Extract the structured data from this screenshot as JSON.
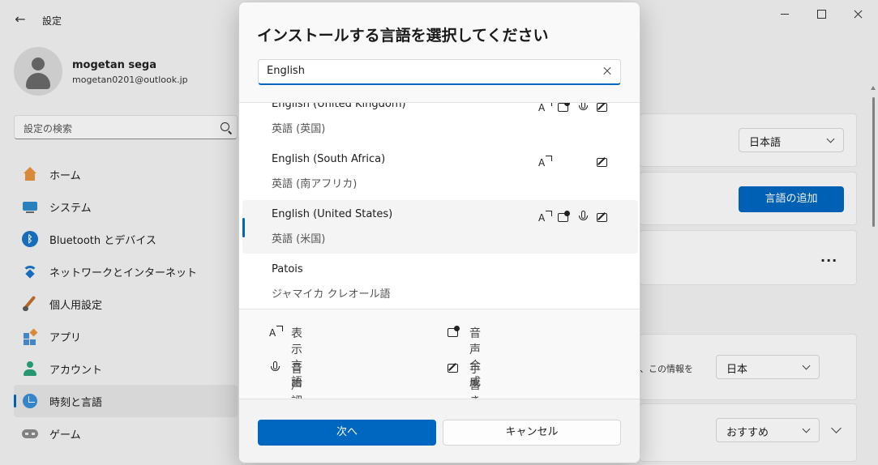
{
  "window": {
    "title": "設定"
  },
  "user": {
    "name": "mogetan sega",
    "email": "mogetan0201@outlook.jp"
  },
  "search": {
    "placeholder": "設定の検索"
  },
  "sidebar": {
    "items": [
      {
        "label": "ホーム",
        "icon": "home-icon"
      },
      {
        "label": "システム",
        "icon": "system-icon"
      },
      {
        "label": "Bluetooth とデバイス",
        "icon": "bluetooth-icon"
      },
      {
        "label": "ネットワークとインターネット",
        "icon": "wifi-icon"
      },
      {
        "label": "個人用設定",
        "icon": "brush-icon"
      },
      {
        "label": "アプリ",
        "icon": "apps-icon"
      },
      {
        "label": "アカウント",
        "icon": "account-icon"
      },
      {
        "label": "時刻と言語",
        "icon": "clock-globe-icon"
      },
      {
        "label": "ゲーム",
        "icon": "controller-icon"
      }
    ],
    "active_index": 7
  },
  "background": {
    "display_language": "日本語",
    "add_language_button": "言語の追加",
    "more_button": "...",
    "region_hint": "、この情報を",
    "region_value": "日本",
    "format_value": "おすすめ"
  },
  "dialog": {
    "title": "インストールする言語を選択してください",
    "search_value": "English",
    "languages": [
      {
        "name": "English (United Kingdom)",
        "native": "英語 (英国)",
        "caps": [
          "display",
          "tts",
          "speech",
          "handwriting"
        ]
      },
      {
        "name": "English (South Africa)",
        "native": "英語 (南アフリカ)",
        "caps": [
          "display",
          "handwriting"
        ]
      },
      {
        "name": "English (United States)",
        "native": "英語 (米国)",
        "caps": [
          "display",
          "tts",
          "speech",
          "handwriting"
        ],
        "selected": true
      },
      {
        "name": "Patois",
        "native": "ジャマイカ クレオール語",
        "caps": []
      }
    ],
    "legend": {
      "display": "表示言語",
      "tts": "音声合成",
      "speech": "音声認識",
      "handwriting": "手書き"
    },
    "next_button": "次へ",
    "cancel_button": "キャンセル"
  },
  "colors": {
    "accent": "#0067c0",
    "dialog_bg": "#f9f9f9"
  }
}
